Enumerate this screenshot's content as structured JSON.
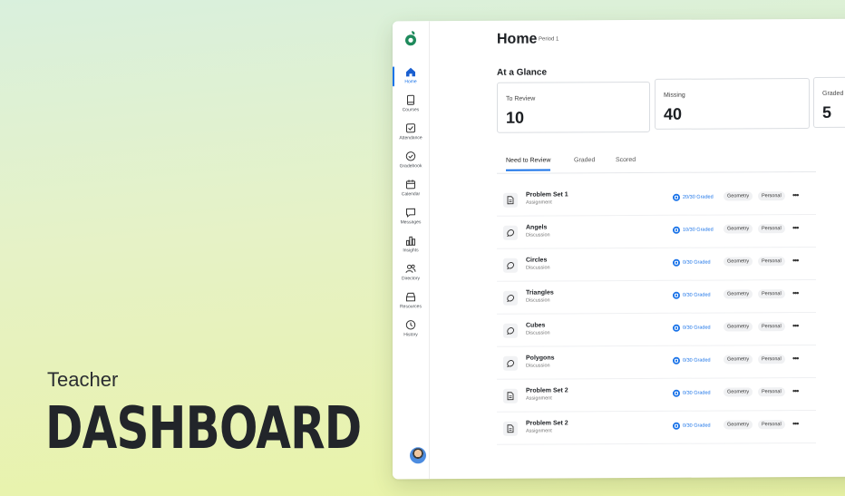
{
  "hero": {
    "subtitle": "Teacher",
    "title": "DASHBOARD"
  },
  "sidebar": {
    "items": [
      {
        "label": "Home",
        "icon": "home-icon",
        "active": true
      },
      {
        "label": "Courses",
        "icon": "book-icon"
      },
      {
        "label": "Attendance",
        "icon": "checkbox-icon"
      },
      {
        "label": "Gradebook",
        "icon": "check-circle-icon"
      },
      {
        "label": "Calendar",
        "icon": "calendar-icon"
      },
      {
        "label": "Messages",
        "icon": "message-icon"
      },
      {
        "label": "Insights",
        "icon": "bar-chart-icon"
      },
      {
        "label": "Directory",
        "icon": "people-icon"
      },
      {
        "label": "Resources",
        "icon": "archive-icon"
      },
      {
        "label": "History",
        "icon": "clock-icon"
      }
    ]
  },
  "header": {
    "title": "Home",
    "period": "Period 1"
  },
  "glance": {
    "title": "At a Glance",
    "stats": [
      {
        "label": "To Review",
        "value": "10"
      },
      {
        "label": "Missing",
        "value": "40"
      },
      {
        "label": "Graded",
        "value": "5"
      }
    ]
  },
  "tabs": [
    {
      "label": "Need to Review",
      "active": true
    },
    {
      "label": "Graded"
    },
    {
      "label": "Scored"
    }
  ],
  "rows": [
    {
      "name": "Problem Set 1",
      "type": "Assignment",
      "graded": "20/30 Graded",
      "course": "Geometry",
      "tag": "Personal"
    },
    {
      "name": "Angels",
      "type": "Discussion",
      "graded": "10/30 Graded",
      "course": "Geometry",
      "tag": "Personal"
    },
    {
      "name": "Circles",
      "type": "Discussion",
      "graded": "0/30 Graded",
      "course": "Geometry",
      "tag": "Personal"
    },
    {
      "name": "Triangles",
      "type": "Discussion",
      "graded": "0/30 Graded",
      "course": "Geometry",
      "tag": "Personal"
    },
    {
      "name": "Cubes",
      "type": "Discussion",
      "graded": "0/30 Graded",
      "course": "Geometry",
      "tag": "Personal"
    },
    {
      "name": "Polygons",
      "type": "Discussion",
      "graded": "0/30 Graded",
      "course": "Geometry",
      "tag": "Personal"
    },
    {
      "name": "Problem Set 2",
      "type": "Assignment",
      "graded": "0/30 Graded",
      "course": "Geometry",
      "tag": "Personal"
    },
    {
      "name": "Problem Set 2",
      "type": "Assignment",
      "graded": "0/30 Graded",
      "course": "Geometry",
      "tag": "Personal"
    }
  ],
  "more_label": "•••",
  "colors": {
    "accent": "#1a73e8",
    "logo": "#1f8a5c"
  }
}
